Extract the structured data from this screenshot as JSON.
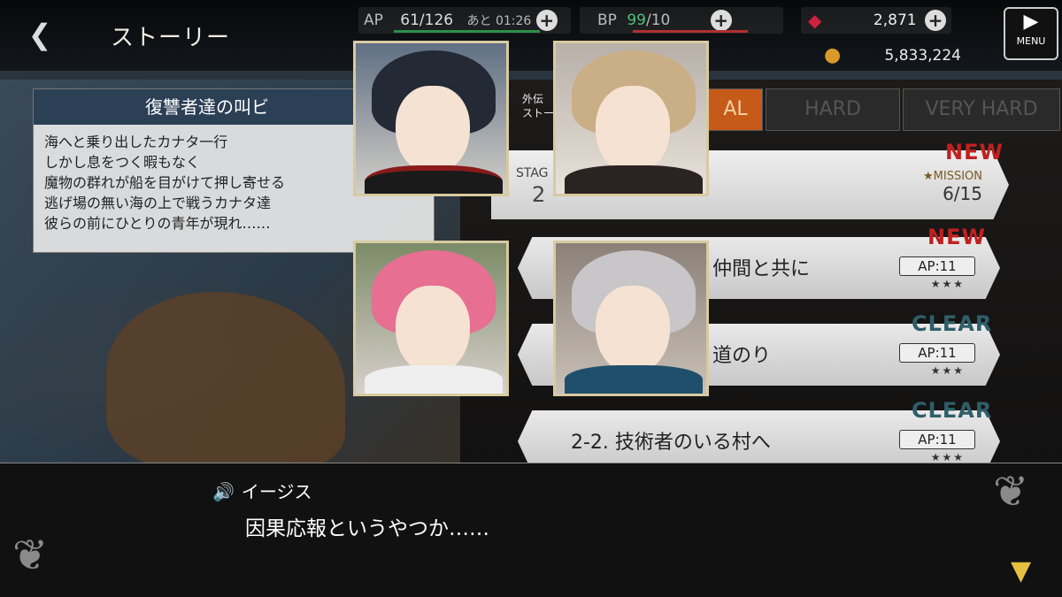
{
  "header": {
    "back_icon": "back-arrow-icon",
    "title": "ストーリー",
    "ap_label": "AP",
    "ap_value": "61/126",
    "ap_timer": "あと 01:26",
    "bp_label": "BP",
    "bp_value": "99",
    "bp_max": "/10",
    "gems": "2,871",
    "gold": "5,833,224",
    "menu_label": "MENU"
  },
  "story": {
    "title": "復讐者達の叫ビ",
    "description": "海へと乗り出したカナタ一行\nしかし息をつく暇もなく\n魔物の群れが船を目がけて押し寄せる\n逃げ場の無い海の上で戦うカナタ達\n彼らの前にひとりの青年が現れ……"
  },
  "side_label": "外伝\nストーリ",
  "tabs": [
    "AL",
    "HARD",
    "VERY HARD"
  ],
  "stage_card": {
    "label": "STAG",
    "number": "2",
    "mission_label": "★MISSION",
    "mission_value": "6/15",
    "badge": "NEW"
  },
  "stages": [
    {
      "name": "仲間と共に",
      "ap": "AP:11",
      "stars": "★★★",
      "badge": "NEW"
    },
    {
      "name": "道のり",
      "ap": "AP:11",
      "stars": "★★★",
      "badge": "CLEAR"
    },
    {
      "name": "2-2. 技術者のいる村へ",
      "ap": "AP:11",
      "stars": "★★★",
      "badge": "CLEAR"
    }
  ],
  "dialog": {
    "speaker": "イージス",
    "text": "因果応報というやつか……"
  },
  "colors": {
    "accent": "#e8c040",
    "new": "#c02020",
    "clear": "#2f5e6a",
    "header_bar": "#2b3f55"
  }
}
